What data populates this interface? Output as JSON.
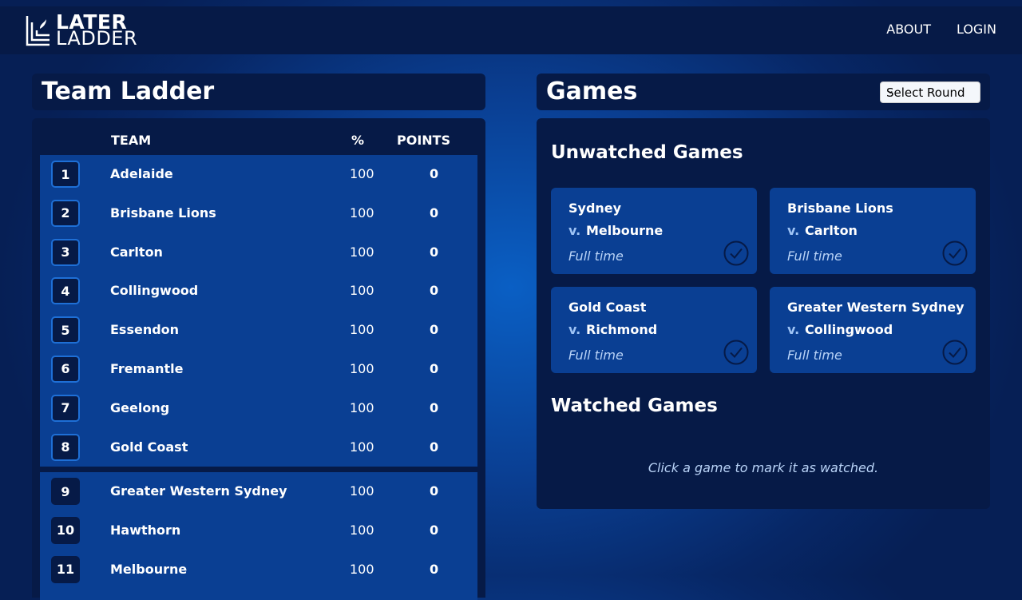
{
  "header": {
    "logo": {
      "line1": "LATER",
      "line2": "LADDER"
    },
    "nav": [
      {
        "label": "ABOUT"
      },
      {
        "label": "LOGIN"
      }
    ]
  },
  "ladder": {
    "title": "Team Ladder",
    "columns": {
      "team": "TEAM",
      "pct": "%",
      "points": "POINTS"
    },
    "rows": [
      {
        "rank": "1",
        "team": "Adelaide",
        "pct": "100",
        "points": "0"
      },
      {
        "rank": "2",
        "team": "Brisbane Lions",
        "pct": "100",
        "points": "0"
      },
      {
        "rank": "3",
        "team": "Carlton",
        "pct": "100",
        "points": "0"
      },
      {
        "rank": "4",
        "team": "Collingwood",
        "pct": "100",
        "points": "0"
      },
      {
        "rank": "5",
        "team": "Essendon",
        "pct": "100",
        "points": "0"
      },
      {
        "rank": "6",
        "team": "Fremantle",
        "pct": "100",
        "points": "0"
      },
      {
        "rank": "7",
        "team": "Geelong",
        "pct": "100",
        "points": "0"
      },
      {
        "rank": "8",
        "team": "Gold Coast",
        "pct": "100",
        "points": "0"
      },
      {
        "rank": "9",
        "team": "Greater Western Sydney",
        "pct": "100",
        "points": "0"
      },
      {
        "rank": "10",
        "team": "Hawthorn",
        "pct": "100",
        "points": "0"
      },
      {
        "rank": "11",
        "team": "Melbourne",
        "pct": "100",
        "points": "0"
      }
    ]
  },
  "games": {
    "title": "Games",
    "round_select": {
      "value": "Select Round"
    },
    "unwatched_title": "Unwatched Games",
    "watched_title": "Watched Games",
    "unwatched": [
      {
        "home": "Sydney",
        "vs": "v.",
        "away": "Melbourne",
        "status": "Full time"
      },
      {
        "home": "Brisbane Lions",
        "vs": "v.",
        "away": "Carlton",
        "status": "Full time"
      },
      {
        "home": "Gold Coast",
        "vs": "v.",
        "away": "Richmond",
        "status": "Full time"
      },
      {
        "home": "Greater Western Sydney",
        "vs": "v.",
        "away": "Collingwood",
        "status": "Full time"
      }
    ],
    "hint": "Click a game to mark it as watched."
  },
  "colors": {
    "bg": "#0a3f93",
    "panel": "#061a47",
    "accent": "#1e6fd6"
  }
}
